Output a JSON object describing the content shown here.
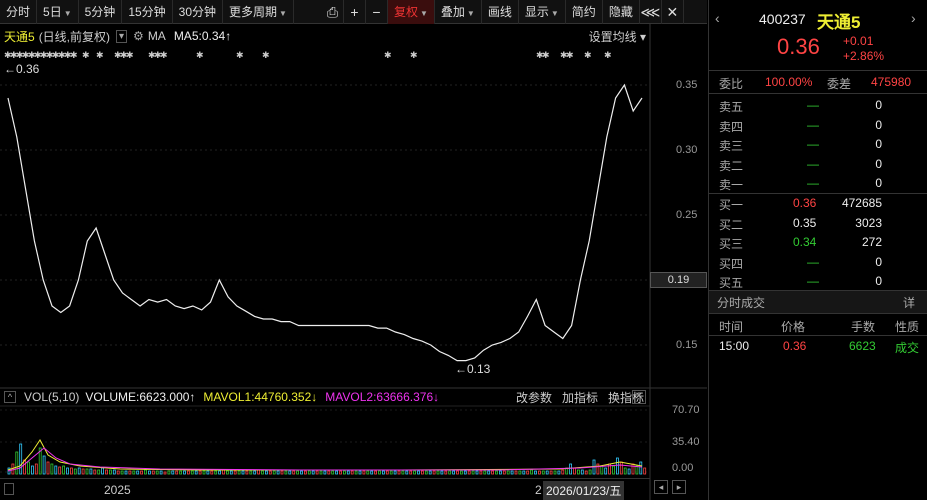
{
  "toolbar": {
    "items": [
      "分时",
      "5日",
      "5分钟",
      "15分钟",
      "30分钟",
      "更多周期",
      "复权",
      "叠加",
      "画线",
      "显示",
      "简约",
      "隐藏"
    ],
    "active": "复权"
  },
  "chart_header": {
    "name": "天通5",
    "mode": "(日线,前复权)",
    "ma_label": "MA",
    "ma5": "MA5:0.34",
    "settings": "设置均线",
    "high_marker": "←0.36",
    "low_marker": "←0.13"
  },
  "price_scale": [
    "0.35",
    "0.30",
    "0.25",
    "0.19",
    "0.15"
  ],
  "volume_header": {
    "label": "VOL(5,10)",
    "volume": "VOLUME:6623.000",
    "mavol1": "MAVOL1:44760.352",
    "mavol2": "MAVOL2:63666.376",
    "btn_params": "改参数",
    "btn_add": "加指标",
    "btn_switch": "换指标"
  },
  "volume_scale": [
    "70.70",
    "35.40",
    "0.00"
  ],
  "x_axis": {
    "year": "2025",
    "cursor_date": "2026/01/23/五",
    "mark": "2"
  },
  "quote": {
    "code": "400237",
    "name": "天通5",
    "price": "0.36",
    "change": "+0.01",
    "change_pct": "+2.86%",
    "weibi_label": "委比",
    "weibi": "100.00%",
    "weicha_label": "委差",
    "weicha": "475980"
  },
  "sells": [
    {
      "label": "卖五",
      "price": "—",
      "vol": "0"
    },
    {
      "label": "卖四",
      "price": "—",
      "vol": "0"
    },
    {
      "label": "卖三",
      "price": "—",
      "vol": "0"
    },
    {
      "label": "卖二",
      "price": "—",
      "vol": "0"
    },
    {
      "label": "卖一",
      "price": "—",
      "vol": "0"
    }
  ],
  "buys": [
    {
      "label": "买一",
      "price": "0.36",
      "vol": "472685"
    },
    {
      "label": "买二",
      "price": "0.35",
      "vol": "3023"
    },
    {
      "label": "买三",
      "price": "0.34",
      "vol": "272"
    },
    {
      "label": "买四",
      "price": "—",
      "vol": "0"
    },
    {
      "label": "买五",
      "price": "—",
      "vol": "0"
    }
  ],
  "trades": {
    "title": "分时成交",
    "detail": "详",
    "headers": [
      "时间",
      "价格",
      "手数",
      "性质"
    ],
    "rows": [
      {
        "time": "15:00",
        "price": "0.36",
        "vol": "6623",
        "type": "成交"
      }
    ]
  },
  "chart_data": {
    "type": "line",
    "price_series": [
      0.34,
      0.31,
      0.27,
      0.23,
      0.2,
      0.18,
      0.175,
      0.18,
      0.2,
      0.23,
      0.24,
      0.22,
      0.2,
      0.19,
      0.185,
      0.18,
      0.185,
      0.183,
      0.185,
      0.18,
      0.178,
      0.18,
      0.177,
      0.183,
      0.2,
      0.187,
      0.18,
      0.176,
      0.172,
      0.17,
      0.17,
      0.168,
      0.168,
      0.165,
      0.165,
      0.165,
      0.165,
      0.165,
      0.165,
      0.165,
      0.165,
      0.165,
      0.163,
      0.163,
      0.16,
      0.158,
      0.155,
      0.153,
      0.15,
      0.145,
      0.142,
      0.138,
      0.138,
      0.14,
      0.146,
      0.15,
      0.152,
      0.155,
      0.16,
      0.172,
      0.185,
      0.165,
      0.16,
      0.155,
      0.165,
      0.2,
      0.23,
      0.27,
      0.31,
      0.34,
      0.35,
      0.33,
      0.34
    ],
    "ylim": [
      0.13,
      0.36
    ]
  }
}
